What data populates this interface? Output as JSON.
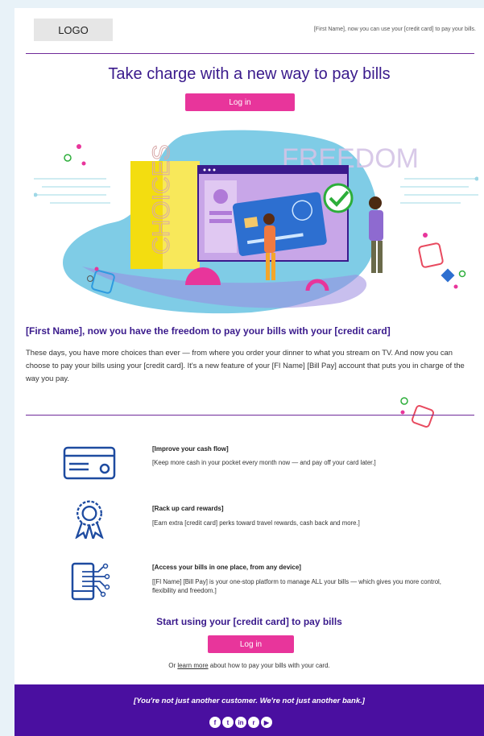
{
  "header": {
    "logo": "LOGO",
    "preheader": "[First Name], now you can use your [credit card] to pay your bills."
  },
  "hero": {
    "headline": "Take charge with a new way to pay bills",
    "login_label": "Log in",
    "illustration_words": [
      "CHOICES",
      "FREEDOM"
    ]
  },
  "intro": {
    "subhead": "[First Name], now you have the freedom to pay your bills with your [credit card]",
    "body": "These days, you have more choices than ever — from where you order your dinner to what you stream on TV. And now you can choose to pay your bills using your [credit card]. It's a new feature of your [FI Name] [Bill Pay] account that puts you in charge of the way you pay."
  },
  "features": [
    {
      "icon": "credit-card-icon",
      "title": "[Improve your cash flow]",
      "desc": "[Keep more cash in your pocket every month now — and pay off your card later.]"
    },
    {
      "icon": "award-ribbon-icon",
      "title": "[Rack up card rewards]",
      "desc": "[Earn extra [credit card] perks toward travel rewards, cash back and more.]"
    },
    {
      "icon": "mobile-device-icon",
      "title": "[Access your bills in one place, from any device]",
      "desc": "[[FI Name] [Bill Pay] is your one-stop platform to manage ALL your bills — which gives you more control, flexibility and freedom.]"
    }
  ],
  "cta": {
    "title": "Start using your [credit card] to pay bills",
    "login_label": "Log in",
    "learn_prefix": "Or ",
    "learn_link": "learn more",
    "learn_suffix": " about how to pay your bills with your card."
  },
  "footer": {
    "tagline": "[You're not just another customer. We're not just another bank.]",
    "social": [
      {
        "icon": "facebook-icon",
        "glyph": "f"
      },
      {
        "icon": "twitter-icon",
        "glyph": "t"
      },
      {
        "icon": "linkedin-icon",
        "glyph": "in"
      },
      {
        "icon": "rss-icon",
        "glyph": "r"
      },
      {
        "icon": "youtube-icon",
        "glyph": "▶"
      }
    ]
  },
  "colors": {
    "brand_purple": "#4a0fa0",
    "heading_purple": "#3a1a8c",
    "button_pink": "#e8359b",
    "page_bg": "#e8f2f8"
  }
}
